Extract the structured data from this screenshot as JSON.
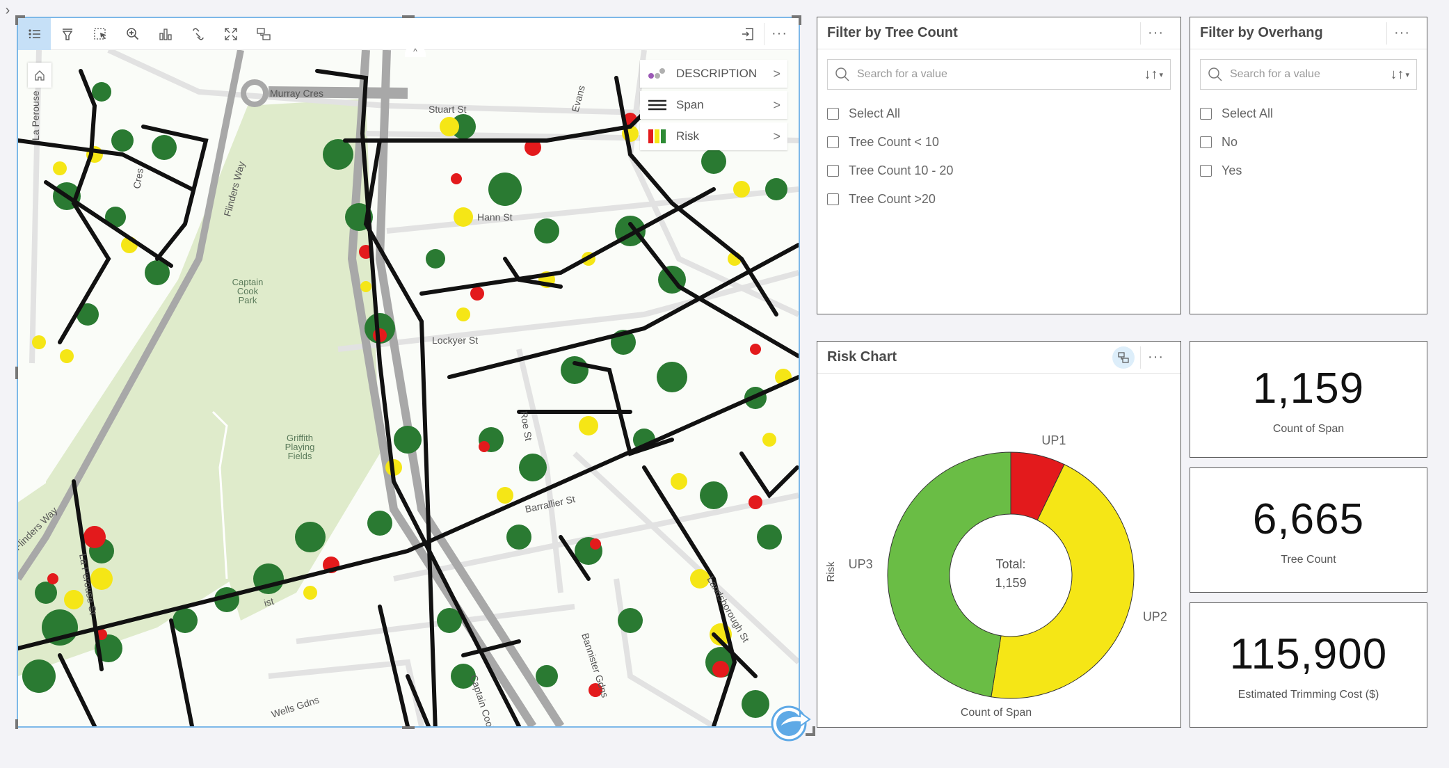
{
  "side_toggle": {
    "icon": "chevron-right-icon",
    "glyph": "›"
  },
  "map": {
    "toolbar": [
      {
        "name": "legend-toggle",
        "icon": "list-icon",
        "active": true
      },
      {
        "name": "filter",
        "icon": "filter-icon"
      },
      {
        "name": "selection",
        "icon": "select-icon"
      },
      {
        "name": "zoom-to",
        "icon": "zoom-in-icon"
      },
      {
        "name": "visualization-type",
        "icon": "bar-chart-icon"
      },
      {
        "name": "link",
        "icon": "link-icon"
      },
      {
        "name": "expand",
        "icon": "expand-icon"
      },
      {
        "name": "sync-extents",
        "icon": "flip-card-icon"
      }
    ],
    "toolbar_right": [
      {
        "name": "export",
        "icon": "export-icon"
      },
      {
        "name": "more",
        "icon": "more-icon",
        "glyph": "···"
      }
    ],
    "collapse_glyph": "^",
    "legend": [
      {
        "label": "DESCRIPTION",
        "swatch": "dots",
        "colors": [
          "#9b59b6",
          "#b0b0b0",
          "#b0b0b0"
        ]
      },
      {
        "label": "Span",
        "swatch": "lines",
        "colors": [
          "#222222"
        ]
      },
      {
        "label": "Risk",
        "swatch": "bars",
        "colors": [
          "#e31a1c",
          "#f5e616",
          "#2e8b35"
        ]
      }
    ],
    "legend_chevron": ">",
    "street_labels": {
      "murray": "Murray Cres",
      "stuart": "Stuart St",
      "hann": "Hann St",
      "lockyer": "Lockyer St",
      "roe": "Roe St",
      "barrallier": "Barrallier St",
      "flinders": "Flinders Way",
      "flinders2": "Flinders Way",
      "la_perouse": "La Perouse",
      "la_perouse2": "La Perouse St",
      "evans": "Evans",
      "landsborough": "Landsborough St",
      "bannister": "Bannister Gdns",
      "wells": "Wells Gdns",
      "captain_cook_cres": "Captain Cook Cres",
      "cres": "Cres",
      "st_partial": "St",
      "ist": "ist"
    },
    "park_labels": {
      "captain_cook": [
        "Captain",
        "Cook",
        "Park"
      ],
      "griffith": [
        "Griffith",
        "Playing",
        "Fields"
      ]
    },
    "colors": {
      "span": "#111111",
      "tree_low": "#2a7a32",
      "tree_medium": "#f5e616",
      "tree_high": "#e31a1c",
      "park": "#dfebcb",
      "road_major": "#a8a8a8",
      "road_minor": "#e2e2e2"
    }
  },
  "filter_tree_count": {
    "title": "Filter by Tree Count",
    "more_glyph": "···",
    "search_placeholder": "Search for a value",
    "sort_glyph": "↓↑",
    "sort_caret": "▾",
    "options": [
      {
        "label": "Select All",
        "checked": false
      },
      {
        "label": "Tree Count < 10",
        "checked": false
      },
      {
        "label": "Tree Count 10 - 20",
        "checked": false
      },
      {
        "label": "Tree Count >20",
        "checked": false
      }
    ]
  },
  "filter_overhang": {
    "title": "Filter by Overhang",
    "more_glyph": "···",
    "search_placeholder": "Search for a value",
    "sort_glyph": "↓↑",
    "sort_caret": "▾",
    "options": [
      {
        "label": "Select All",
        "checked": false
      },
      {
        "label": "No",
        "checked": false
      },
      {
        "label": "Yes",
        "checked": false
      }
    ]
  },
  "risk_chart": {
    "title": "Risk Chart",
    "more_glyph": "···",
    "flip_icon": "flip-card-icon"
  },
  "chart_data": {
    "type": "pie",
    "subtype": "donut",
    "title": "Risk Chart",
    "xlabel": "Count of Span",
    "ylabel": "Risk",
    "center_label": "Total:",
    "center_value": "1,159",
    "total": 1159,
    "categories": [
      "UP1",
      "UP2",
      "UP3"
    ],
    "values": [
      83,
      526,
      550
    ],
    "colors": [
      "#e31a1c",
      "#f5e616",
      "#6abd45"
    ],
    "start": "12 o'clock",
    "direction": "clockwise"
  },
  "kpis": [
    {
      "value": "1,159",
      "label": "Count of Span"
    },
    {
      "value": "6,665",
      "label": "Tree Count"
    },
    {
      "value": "115,900",
      "label": "Estimated Trimming Cost ($)"
    }
  ]
}
